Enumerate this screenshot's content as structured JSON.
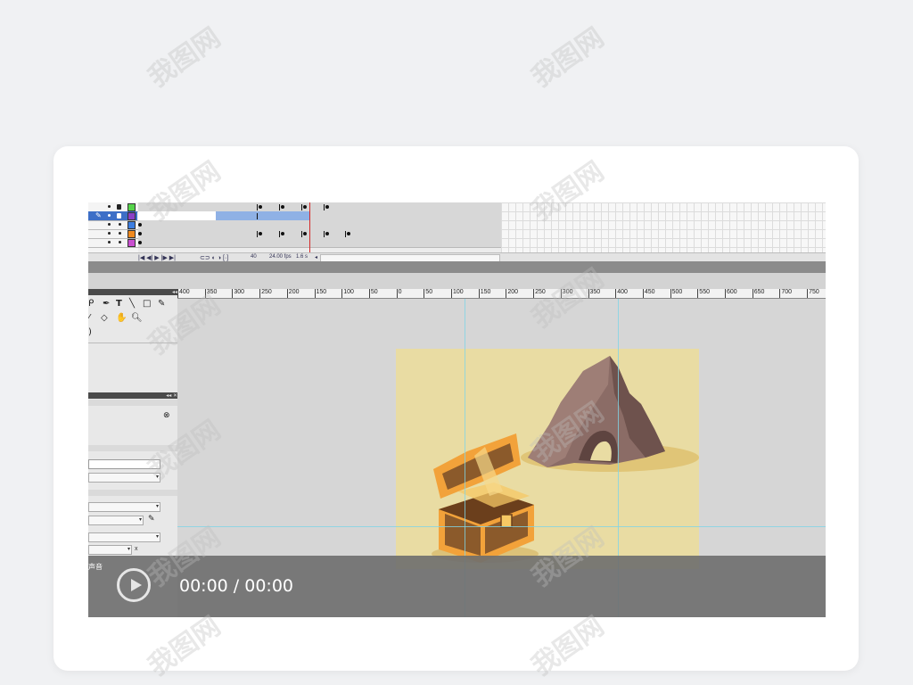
{
  "timeline": {
    "layers": [
      {
        "color": "#55d34a",
        "selected": false
      },
      {
        "color": "#8a3fc6",
        "selected": true
      },
      {
        "color": "#3d7ee0",
        "selected": false
      },
      {
        "color": "#f08a1f",
        "selected": false
      },
      {
        "color": "#c94fd0",
        "selected": false
      }
    ],
    "status": {
      "frame": "40",
      "fps": "24.00 fps",
      "seconds": "1.6 s"
    }
  },
  "ruler": {
    "labels": [
      "400",
      "350",
      "300",
      "250",
      "200",
      "150",
      "100",
      "50",
      "0",
      "50",
      "100",
      "150",
      "200",
      "250",
      "300",
      "350",
      "400",
      "450",
      "500",
      "550",
      "600",
      "650",
      "700",
      "750"
    ]
  },
  "properties": {
    "sound_label": "声音"
  },
  "video": {
    "time_display": "00:00 / 00:00"
  },
  "watermark": {
    "text": "我图网"
  },
  "colors": {
    "stage": "#e9dca3",
    "workspace": "#d6d6d6",
    "chest_orange": "#f2a23a",
    "chest_wood": "#8b5a2b",
    "rock": "#8b6c66"
  }
}
